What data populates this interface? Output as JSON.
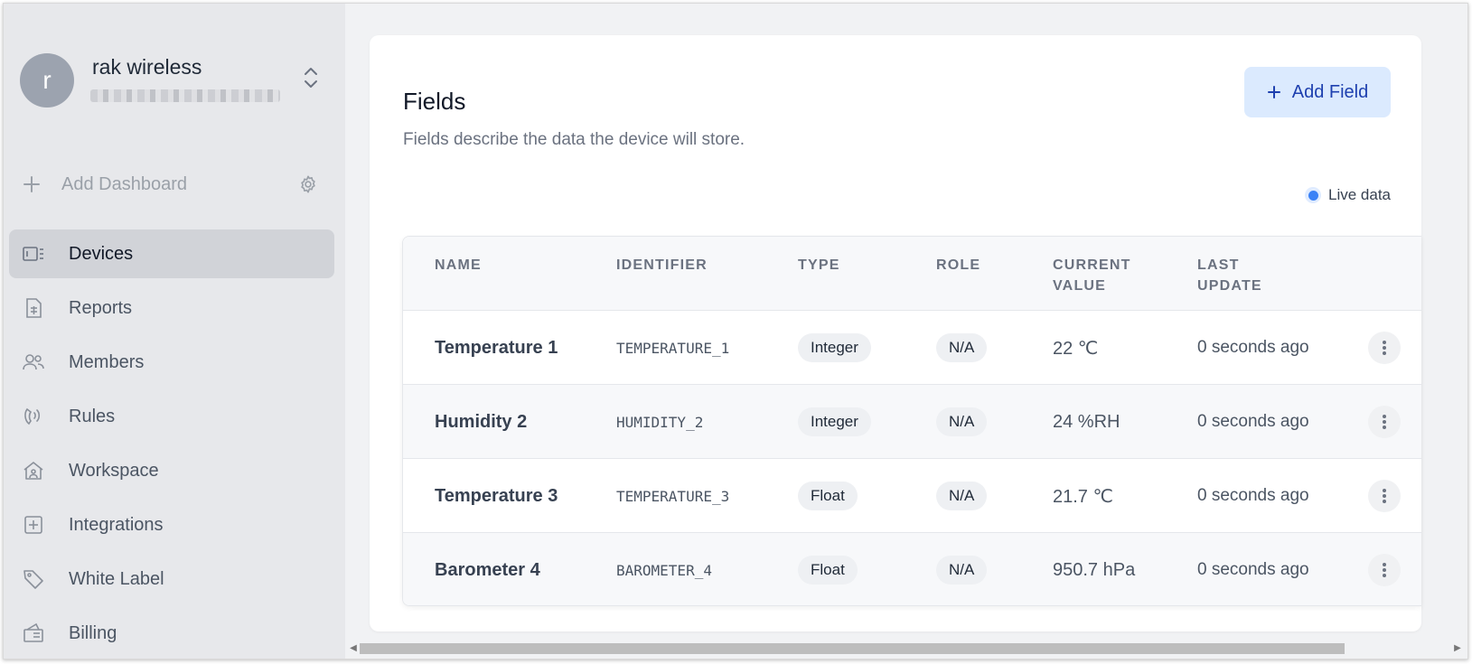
{
  "org": {
    "avatar_letter": "r",
    "name": "rak wireless"
  },
  "sidebar": {
    "add_dashboard_label": "Add Dashboard",
    "items": [
      {
        "label": "Devices",
        "icon": "devices-icon",
        "active": true
      },
      {
        "label": "Reports",
        "icon": "reports-icon"
      },
      {
        "label": "Members",
        "icon": "members-icon"
      },
      {
        "label": "Rules",
        "icon": "rules-icon"
      },
      {
        "label": "Workspace",
        "icon": "workspace-icon"
      },
      {
        "label": "Integrations",
        "icon": "integrations-icon"
      },
      {
        "label": "White Label",
        "icon": "tag-icon"
      },
      {
        "label": "Billing",
        "icon": "billing-icon"
      }
    ]
  },
  "fields": {
    "title": "Fields",
    "description": "Fields describe the data the device will store.",
    "add_button": "Add Field",
    "live_label": "Live data",
    "live_color": "#3b82f6",
    "columns": {
      "name": "NAME",
      "identifier": "IDENTIFIER",
      "type": "TYPE",
      "role": "ROLE",
      "current_value_1": "CURRENT",
      "current_value_2": "VALUE",
      "last_update_1": "LAST",
      "last_update_2": "UPDATE"
    },
    "rows": [
      {
        "name": "Temperature 1",
        "identifier": "TEMPERATURE_1",
        "type": "Integer",
        "role": "N/A",
        "value": "22 ℃",
        "updated": "0 seconds ago"
      },
      {
        "name": "Humidity 2",
        "identifier": "HUMIDITY_2",
        "type": "Integer",
        "role": "N/A",
        "value": "24 %RH",
        "updated": "0 seconds ago"
      },
      {
        "name": "Temperature 3",
        "identifier": "TEMPERATURE_3",
        "type": "Float",
        "role": "N/A",
        "value": "21.7 ℃",
        "updated": "0 seconds ago"
      },
      {
        "name": "Barometer 4",
        "identifier": "BAROMETER_4",
        "type": "Float",
        "role": "N/A",
        "value": "950.7 hPa",
        "updated": "0 seconds ago"
      }
    ]
  }
}
